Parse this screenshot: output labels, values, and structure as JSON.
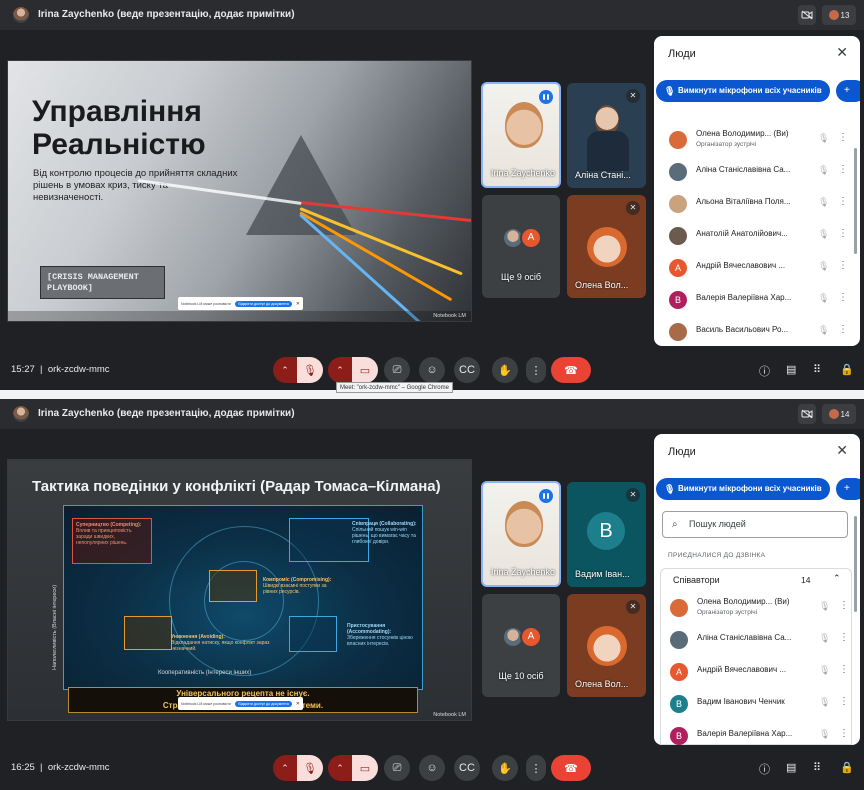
{
  "screens": [
    {
      "presenter_text": "Irina Zaychenko (веде презентацію, додає примітки)",
      "participant_count": "13",
      "slide": {
        "title": "Управління Реальністю",
        "subtitle": "Від контролю процесів до прийняття складних рішень в умовах криз, тиску та невизначеності.",
        "tag": "[CRISIS MANAGEMENT PLAYBOOK]",
        "watermark": "Notebook LM"
      },
      "tiles": {
        "presenter": "Irina Zaychenko",
        "second": "Аліна Стані...",
        "more": "Ще 9 осіб",
        "more_avatar_letter": "А",
        "olena": "Олена Вол..."
      },
      "panel": {
        "title": "Люди",
        "mute_all": "Вимкнути мікрофони всіх учасників",
        "people": [
          {
            "name": "Олена Володимир... (Ви)",
            "role": "Організатор зустрічі",
            "letter": "",
            "color": "#d96a3a"
          },
          {
            "name": "Аліна Станіславівна Са...",
            "role": "",
            "letter": "",
            "color": "#5a6c7a"
          },
          {
            "name": "Альона Віталіївна Поля...",
            "role": "",
            "letter": "",
            "color": "#c9a27e"
          },
          {
            "name": "Анатолій Анатолійович...",
            "role": "",
            "letter": "",
            "color": "#6b5a4e"
          },
          {
            "name": "Андрій Вячеславович ...",
            "role": "",
            "letter": "А",
            "color": "#e8582e"
          },
          {
            "name": "Валерія Валеріївна Хар...",
            "role": "",
            "letter": "В",
            "color": "#b0205e"
          },
          {
            "name": "Василь Васильович Ро...",
            "role": "",
            "letter": "",
            "color": "#a86b4a"
          }
        ]
      },
      "bottom": {
        "time": "15:27",
        "code": "ork-zcdw-mmc"
      },
      "tooltip": "Meet: \"ork-zcdw-mmc\" – Google Chrome"
    },
    {
      "presenter_text": "Irina Zaychenko (веде презентацію, додає примітки)",
      "participant_count": "14",
      "slide": {
        "title": "Тактика поведінки у конфлікті (Радар Томаса–Кілмана)",
        "q_competing_title": "Суперництво (Competing):",
        "q_competing_body": "Вплив та принциповість заради швидких, непопулярних рішень.",
        "q_collab_title": "Співпраця (Collaborating):",
        "q_collab_body": "Спільний пошук win-win рішень, що вимагає часу та глибокої довіри.",
        "q_comp_title": "Компроміс (Compromising):",
        "q_comp_body": "Швидкі взаємні поступки за рівних ресурсів.",
        "q_avoid_title": "Уникнення (Avoiding):",
        "q_avoid_body": "Відкладання натиску, якщо конфлікт зараз незначний.",
        "q_accom_title": "Пристосування (Accommodating):",
        "q_accom_body": "Збереження стосунків ціною власних інтересів.",
        "axis_y": "Наполегливість (Власні інтереси)",
        "axis_x": "Кооперативність (Інтереси інших)",
        "strip_line1": "Універсального рецепта не існує.",
        "strip_line2": "Стратегія обирає... ...контексту системи.",
        "watermark": "Notebook LM"
      },
      "tiles": {
        "presenter": "Irina Zaychenko",
        "second": "Вадим Іван...",
        "second_letter": "В",
        "more": "Ще 10 осіб",
        "more_avatar_letter": "А",
        "olena": "Олена Вол..."
      },
      "panel": {
        "title": "Люди",
        "mute_all": "Вимкнути мікрофони всіх учасників",
        "search_placeholder": "Пошук людей",
        "joined_label": "ПРИЄДНАЛИСЯ ДО ДЗВІНКА",
        "group_label": "Співавтори",
        "group_count": "14",
        "people": [
          {
            "name": "Олена Володимир... (Ви)",
            "role": "Організатор зустрічі",
            "letter": "",
            "color": "#d96a3a"
          },
          {
            "name": "Аліна Станіславівна Са...",
            "role": "",
            "letter": "",
            "color": "#5a6c7a"
          },
          {
            "name": "Андрій Вячеславович ...",
            "role": "",
            "letter": "А",
            "color": "#e8582e"
          },
          {
            "name": "Вадим Іванович Ченчик",
            "role": "",
            "letter": "В",
            "color": "#1e7f8c"
          },
          {
            "name": "Валерія Валеріївна Хар...",
            "role": "",
            "letter": "В",
            "color": "#b0205e"
          }
        ]
      },
      "bottom": {
        "time": "16:25",
        "code": "ork-zcdw-mmc"
      }
    }
  ],
  "banner": {
    "message": "Notebook LM може розповісти про цей документ",
    "button": "Відкрити доступ до документа",
    "close": "✕"
  },
  "icons": {
    "mic_off": "mic-off-icon",
    "cam_off": "camera-off-icon",
    "present": "present-icon",
    "emoji": "emoji-icon",
    "captions": "captions-icon",
    "hand": "raise-hand-icon",
    "more": "more-vert-icon",
    "end": "end-call-icon",
    "info": "info-icon",
    "chat": "chat-icon",
    "activities": "apps-icon",
    "lock": "host-controls-icon"
  },
  "colors": {
    "accent": "#0b57d0",
    "danger": "#ea4335",
    "muted_bg": "#8c1d18",
    "muted_fg": "#f9dedc"
  }
}
